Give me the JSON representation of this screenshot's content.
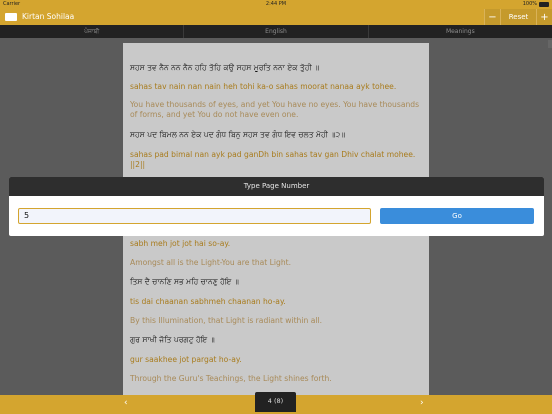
{
  "status_bar": {
    "carrier": "Carrier",
    "time": "2:44 PM",
    "battery": "100%"
  },
  "navbar": {
    "title": "Kirtan Sohilaa",
    "minus": "−",
    "reset": "Reset",
    "plus": "+"
  },
  "tabs": [
    "ਪੰਜਾਬੀ",
    "English",
    "Meanings"
  ],
  "content": [
    {
      "type": "gurmukhi",
      "text": "ਸਹਸ ਤਵ ਨੈਨ ਨਨ ਨੈਨ ਹਹਿ ਤੋਹਿ ਕਉ ਸਹਸ ਮੂਰਤਿ ਨਨਾ ਏਕ ਤੁੋਹੀ ॥"
    },
    {
      "type": "translit",
      "text": "sahas tav nain nan nain heh tohi ka-o sahas moorat nanaa ayk tohee."
    },
    {
      "type": "meaning",
      "text": "You have thousands of eyes, and yet You have no eyes. You have thousands of forms, and yet You do not have even one."
    },
    {
      "type": "gurmukhi",
      "text": "ਸਹਸ ਪਦ ਬਿਮਲ ਨਨ ਏਕ ਪਦ ਗੰਧ ਬਿਨੁ ਸਹਸ ਤਵ ਗੰਧ ਇਵ ਚਲਤ ਮੋਹੀ ॥੨॥"
    },
    {
      "type": "translit",
      "text": "sahas pad bimal nan ayk pad ganDh bin sahas tav gan Dhiv chalat mohee. ||2||"
    },
    {
      "type": "translit",
      "text": "sabh meh jot jot hai so-ay."
    },
    {
      "type": "meaning",
      "text": "Amongst all is the Light-You are that Light."
    },
    {
      "type": "gurmukhi",
      "text": "ਤਿਸ ਦੈ ਚਾਨਣਿ ਸਭ ਮਹਿ ਚਾਨਣੁ ਹੋਇ ॥"
    },
    {
      "type": "translit",
      "text": "tis dai chaanan sabhmeh chaanan ho-ay."
    },
    {
      "type": "meaning",
      "text": "By this Illumination, that Light is radiant within all."
    },
    {
      "type": "gurmukhi",
      "text": "ਗੁਰ ਸਾਖੀ ਜੋਤਿ ਪਰਗਟੁ ਹੋਇ ॥"
    },
    {
      "type": "translit",
      "text": "gur saakhee jot pargat ho-ay."
    },
    {
      "type": "meaning",
      "text": "Through the Guru's Teachings, the Light shines forth."
    }
  ],
  "modal": {
    "title": "Type Page Number",
    "input_value": "5",
    "go_label": "Go"
  },
  "bottom_bar": {
    "prev": "‹",
    "next": "›",
    "page_indicator": "4 (8)"
  }
}
